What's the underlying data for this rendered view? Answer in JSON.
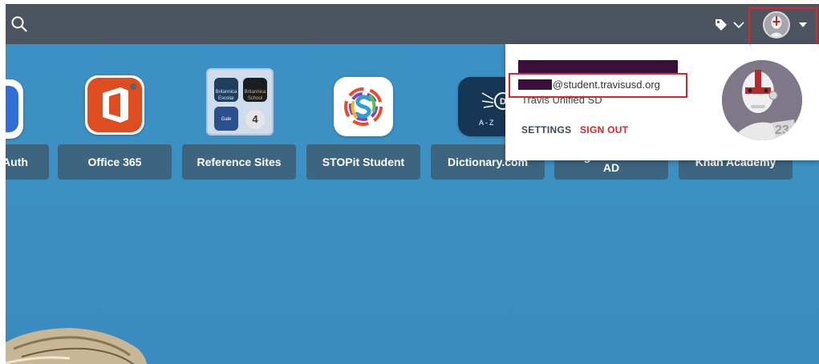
{
  "topbar": {
    "search_icon": "search-icon",
    "tag_icon": "tag-icon",
    "dropdown_icon": "chevron-down-icon",
    "avatar_caret": "caret-down-icon"
  },
  "apps": [
    {
      "label": "Auth",
      "icon": "auth-app-icon"
    },
    {
      "label": "Office 365",
      "icon": "office-365-icon"
    },
    {
      "label": "Reference Sites",
      "icon": "folder-icon",
      "folder_count": "4",
      "folder_labels": [
        "Britannica Escolar",
        "Britannica School",
        "Gale"
      ]
    },
    {
      "label": "STOPit Student",
      "icon": "stopit-icon"
    },
    {
      "label": "Dictionary.com",
      "icon": "dictionary-icon",
      "icon_text": "A-Z"
    },
    {
      "label": "Google Classroom AD",
      "icon": "google-classroom-icon"
    },
    {
      "label": "Khan Academy",
      "icon": "khan-academy-icon"
    }
  ],
  "profile_menu": {
    "email_domain": "@student.travisusd.org",
    "district": "Travis Unified SD",
    "settings_label": "SETTINGS",
    "signout_label": "SIGN OUT",
    "avatar_number": "23"
  },
  "colors": {
    "topbar": "#4b545f",
    "background": "#3a8fc4",
    "highlight_red": "#d9252b",
    "signout_red": "#d9252b",
    "redaction": "#3a0f3c"
  }
}
